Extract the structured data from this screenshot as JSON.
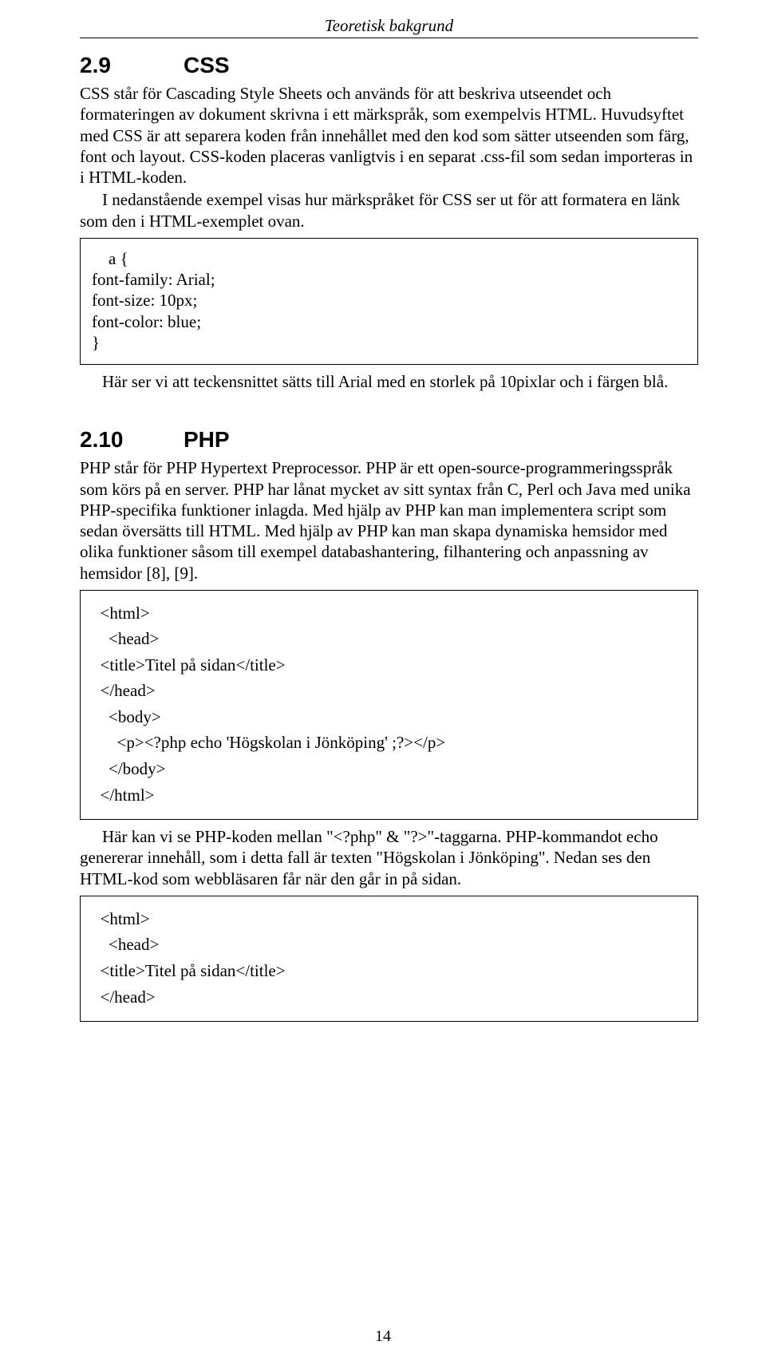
{
  "running_header": "Teoretisk bakgrund",
  "section29": {
    "num": "2.9",
    "title": "CSS",
    "p1": "CSS står för Cascading Style Sheets och används för att beskriva utseendet och formateringen av dokument skrivna i ett märkspråk, som exempelvis HTML. Huvudsyftet med CSS är att separera koden från innehållet med den kod som sätter utseenden som färg, font och layout. CSS-koden placeras vanligtvis i en separat .css-fil som sedan importeras in i HTML-koden.",
    "p2": "I nedanstående exempel visas hur märkspråket för CSS ser ut för att formatera en länk som den i HTML-exemplet ovan.",
    "code1": {
      "l1": "    a {",
      "l2": "font-family: Arial;",
      "l3": "font-size: 10px;",
      "l4": "font-color: blue;",
      "l5": "}"
    },
    "p3": "Här ser vi att teckensnittet sätts till Arial med en storlek på 10pixlar och i färgen blå."
  },
  "section210": {
    "num": "2.10",
    "title": "PHP",
    "p1": "PHP står för PHP Hypertext Preprocessor. PHP är ett open-source-programmeringsspråk som körs på en server. PHP har lånat mycket av sitt syntax från C, Perl och Java med unika PHP-specifika funktioner inlagda. Med hjälp av PHP kan man implementera script som sedan översätts till HTML. Med hjälp av PHP kan man skapa dynamiska hemsidor med olika funktioner såsom till exempel databashantering, filhantering och anpassning av hemsidor [8], [9].",
    "code1": {
      "l1": "  <html>",
      "l2": "    <head>",
      "l3": "  <title>Titel på sidan</title>",
      "l4": "  </head>",
      "l5": "    <body>",
      "l6": "      <p><?php echo 'Högskolan i Jönköping' ;?></p>",
      "l7": "    </body>",
      "l8": "  </html>"
    },
    "p2": "Här kan vi se PHP-koden mellan \"<?php\" & \"?>\"-taggarna. PHP-kommandot echo genererar innehåll, som i detta fall är texten \"Högskolan i Jönköping\". Nedan ses den HTML-kod som webbläsaren får när den går in på sidan.",
    "code2": {
      "l1": "  <html>",
      "l2": "    <head>",
      "l3": "  <title>Titel på sidan</title>",
      "l4": "  </head>"
    }
  },
  "page_number": "14"
}
